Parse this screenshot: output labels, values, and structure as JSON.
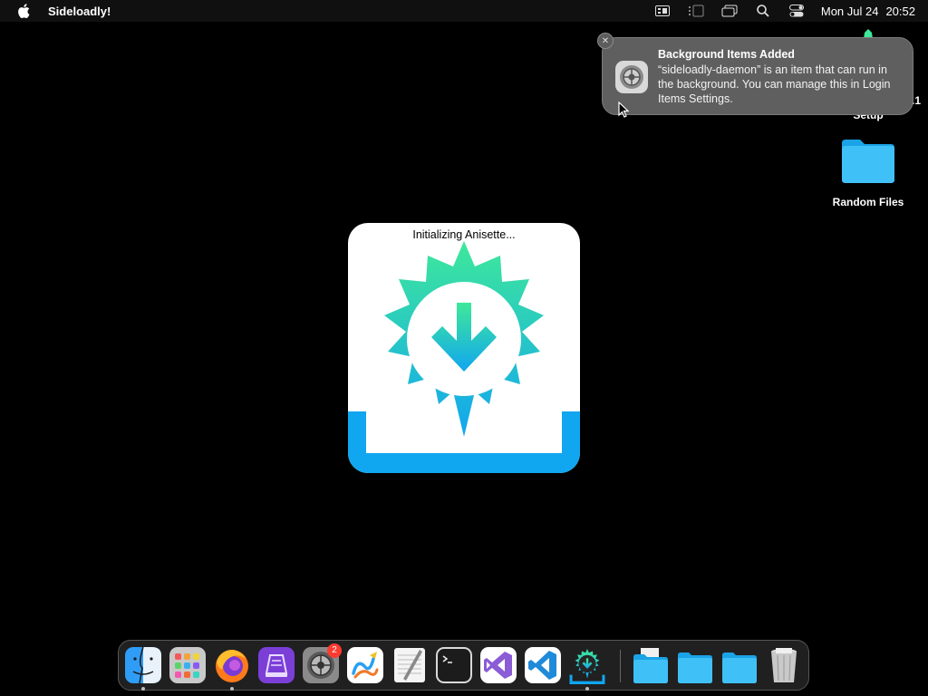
{
  "menubar": {
    "app_name": "Sideloadly!",
    "icons": [
      "apple-icon",
      "keyboard-input-icon",
      "stage-manager-icon",
      "screen-mirror-icon",
      "spotlight-search-icon",
      "control-center-icon"
    ],
    "day_date": "Mon Jul 24",
    "time": "20:52"
  },
  "desktop": {
    "items": [
      {
        "label": "Setup",
        "icon": "app-icon"
      },
      {
        "label": "Random Files",
        "icon": "folder-icon"
      }
    ],
    "partial_text": ".1"
  },
  "notification": {
    "title": "Background Items Added",
    "body": "“sideloadly-daemon” is an item that can run in the background. You can manage this in Login Items Settings.",
    "icon": "system-settings-icon",
    "close_icon": "close-icon"
  },
  "splash": {
    "status_text": "Initializing Anisette...",
    "icon": "sideloadly-gear-download-icon",
    "colors": {
      "green": "#3ee89a",
      "blue": "#11a6f0"
    }
  },
  "dock": {
    "apps": [
      "finder",
      "launchpad",
      "firefox",
      "apple-configurator",
      "system-settings",
      "freeform",
      "textedit",
      "terminal",
      "visual-studio",
      "vscode",
      "sideloadly"
    ],
    "badge_count": "2",
    "stacks": [
      "documents-folder",
      "folder",
      "folder",
      "trash"
    ]
  }
}
